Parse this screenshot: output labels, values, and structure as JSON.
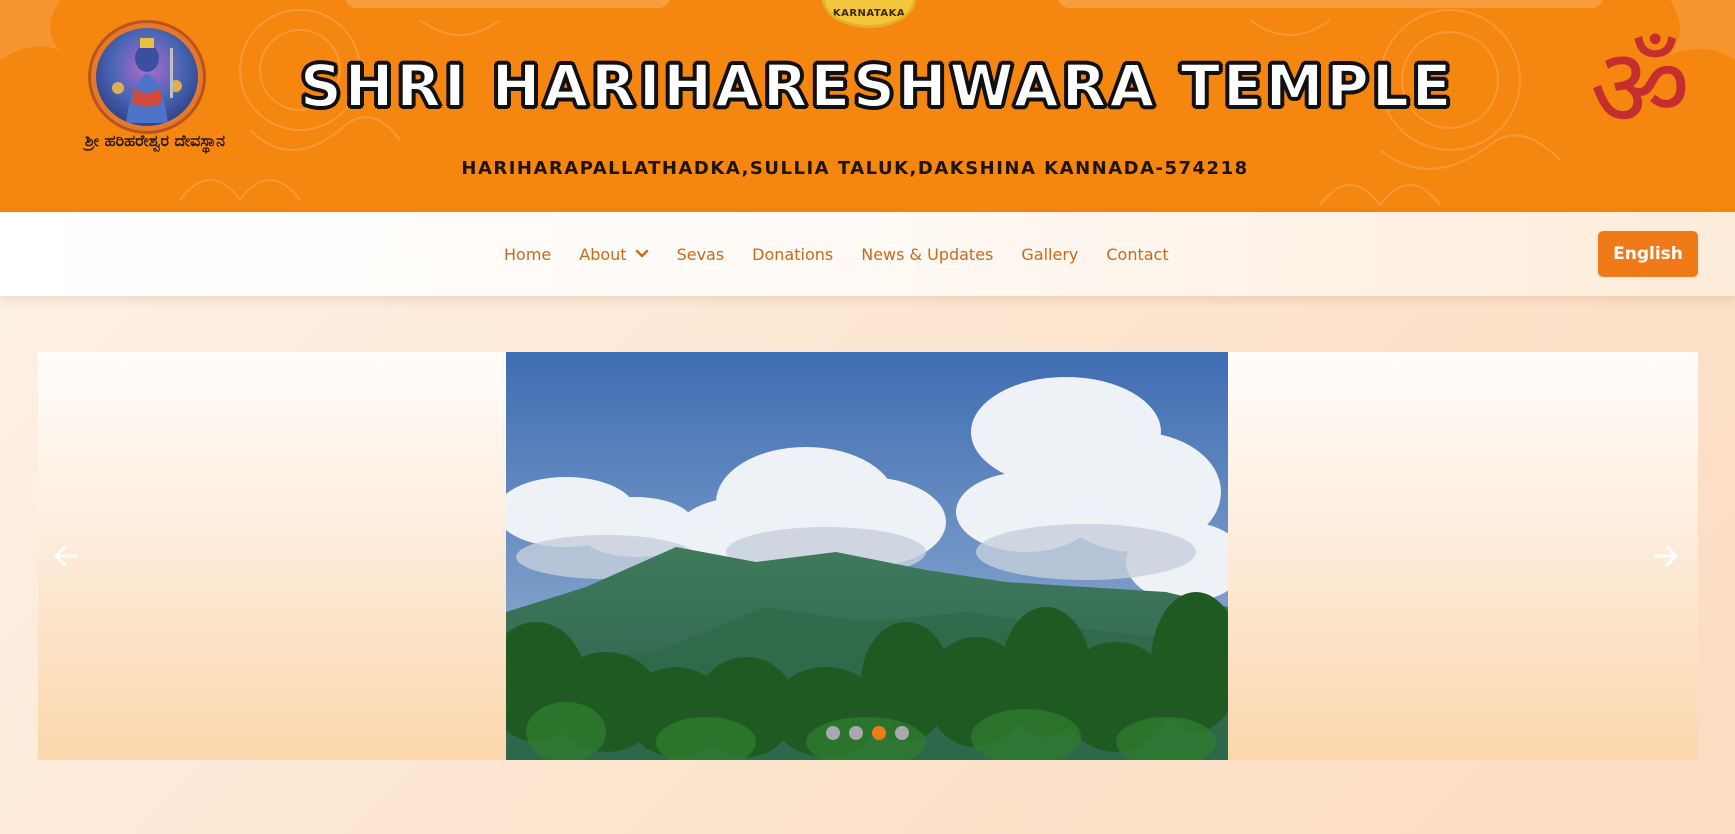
{
  "header": {
    "title": "SHRI HARIHARESHWARA TEMPLE",
    "address": "HARIHARAPALLATHADKA,SULLIA TALUK,DAKSHINA KANNADA-574218",
    "logo_caption": "ಶ್ರೀ ಹರಿಹರೇಶ್ವರ ದೇವಸ್ಥಾನ",
    "emblem_text": "KARNATAKA",
    "om_symbol": "ॐ",
    "icons": {
      "logo": "deity-logo-icon",
      "emblem": "karnataka-emblem-icon",
      "om": "om-icon"
    }
  },
  "nav": {
    "items": [
      {
        "label": "Home"
      },
      {
        "label": "About",
        "has_dropdown": true
      },
      {
        "label": "Sevas"
      },
      {
        "label": "Donations"
      },
      {
        "label": "News & Updates"
      },
      {
        "label": "Gallery"
      },
      {
        "label": "Contact"
      }
    ],
    "language_button": "English"
  },
  "carousel": {
    "slide_count": 4,
    "active_index": 2,
    "slide_description_icon": "mountain-landscape-image",
    "prev_icon": "arrow-left-icon",
    "next_icon": "arrow-right-icon"
  },
  "colors": {
    "banner": "#f5860f",
    "accent": "#f07a18",
    "nav_text": "#c96a1a",
    "om": "#c42e2e",
    "dot_inactive": "#a8aab0"
  }
}
